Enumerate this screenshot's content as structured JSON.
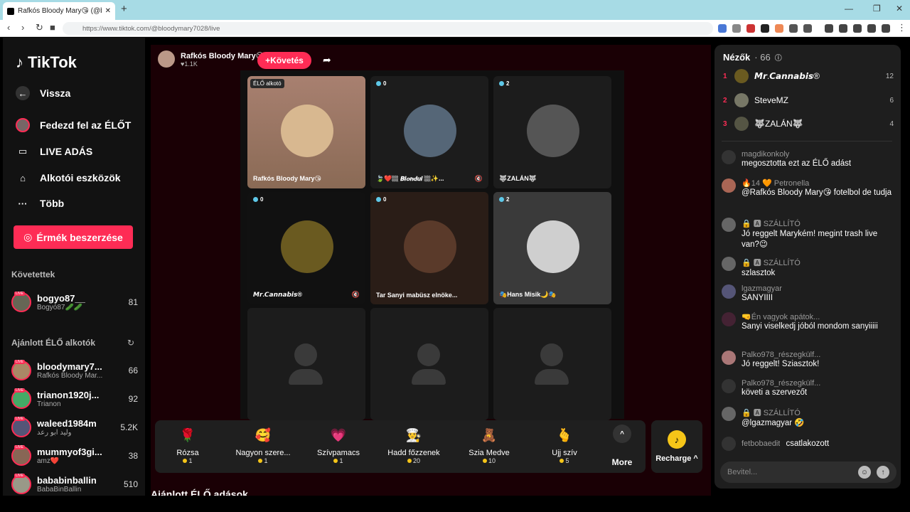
{
  "browser": {
    "tab_title": "Rafkós Bloody Mary😘 (@bl...",
    "url": "https://www.tiktok.com/@bloodymary7028/live"
  },
  "sidebar": {
    "logo": "TikTok",
    "back": "Vissza",
    "nav": [
      {
        "label": "Fedezd fel az ÉLŐT",
        "icon": "avatar-icon"
      },
      {
        "label": "LIVE ADÁS",
        "icon": "video-icon"
      },
      {
        "label": "Alkotói eszközök",
        "icon": "home-icon"
      },
      {
        "label": "Több",
        "icon": "more-icon"
      }
    ],
    "coins_button": "Érmék beszerzése",
    "following_title": "Követettek",
    "following": [
      {
        "name": "bogyo87__",
        "sub": "Bogyó87🥒🥒",
        "count": "81"
      }
    ],
    "recommended_title": "Ajánlott ÉLŐ alkotók",
    "recommended": [
      {
        "name": "bloodymary7...",
        "sub": "Rafkós Bloody Mar...",
        "count": "66"
      },
      {
        "name": "trianon1920j...",
        "sub": "Trianon",
        "count": "92"
      },
      {
        "name": "waleed1984m",
        "sub": "وليد ابو رعد",
        "count": "5.2K"
      },
      {
        "name": "mummyof3gi...",
        "sub": "amz❤️",
        "count": "38"
      },
      {
        "name": "bababinballin",
        "sub": "BabaBinBallin",
        "count": "510"
      }
    ]
  },
  "stream": {
    "host_name": "Rafkós Bloody Mary😘",
    "host_likes": "♥1.1K",
    "follow_label": "+Követés",
    "live_badge": "ÉLŐ alkotó",
    "tiles": [
      {
        "label": "Rafkós Bloody Mary😘",
        "badge": "",
        "color": "#c9a27a",
        "bg": "#8a6a55"
      },
      {
        "label": "🍃❤️🏼 𝘽𝙡𝙤𝙣𝙙𝙪𝙡 🏼✨...",
        "badge": "0",
        "color": "#556677",
        "bg": "#222"
      },
      {
        "label": "🐺ZALÁN🐺",
        "badge": "2",
        "color": "#555",
        "bg": "#1a1a1a"
      },
      {
        "label": "𝙈𝙧.𝘾𝙖𝙣𝙣𝙖𝙗𝙞𝙨®",
        "badge": "0",
        "color": "#6a5a20",
        "bg": "#111"
      },
      {
        "label": "Tar Sanyi mabüsz elnöke...",
        "badge": "0",
        "color": "#5a3a2a",
        "bg": "#2a1d17"
      },
      {
        "label": "🎭Hans Misik🌙🎭",
        "badge": "2",
        "color": "#cfcfcf",
        "bg": "#3a3a3a"
      }
    ],
    "gifts": [
      {
        "name": "Rózsa",
        "price": "1",
        "icon": "🌹"
      },
      {
        "name": "Nagyon szere...",
        "price": "1",
        "icon": "🥰"
      },
      {
        "name": "Szívpamacs",
        "price": "1",
        "icon": "💗"
      },
      {
        "name": "Hadd főzzenek",
        "price": "20",
        "icon": "👨‍🍳"
      },
      {
        "name": "Szia Medve",
        "price": "10",
        "icon": "🧸"
      },
      {
        "name": "Ujj szív",
        "price": "5",
        "icon": "🫰"
      }
    ],
    "more_label": "More",
    "recharge_label": "Recharge ^",
    "recommended_live": "Ajánlott ÉLŐ adások"
  },
  "viewers": {
    "title": "Nézők",
    "count": "· 66",
    "top": [
      {
        "rank": "1",
        "name": "𝙈𝙧.𝘾𝙖𝙣𝙣𝙖𝙗𝙞𝙨®",
        "score": "12"
      },
      {
        "rank": "2",
        "name": "SteveMZ",
        "score": "6"
      },
      {
        "rank": "3",
        "name": "🐺ZALÁN🐺",
        "score": "4"
      }
    ]
  },
  "chat": {
    "messages": [
      {
        "user": "magdikonkoly",
        "text": "megosztotta ezt az ÉLŐ adást"
      },
      {
        "user": "🔥14 🧡 Petronella",
        "text": "@Rafkós Bloody Mary😘 fotelbol de tudja"
      },
      {
        "user": "🔒 🅰 SZÁLLÍTÓ",
        "text": "Jó reggelt Marykém! megint trash live van?😉"
      },
      {
        "user": "🔒 🅰 SZÁLLÍTÓ",
        "text": "szlasztok"
      },
      {
        "user": "lgazmagyar",
        "text": "SANYIIII"
      },
      {
        "user": "🤜Én vagyok apátok...",
        "text": "Sanyi viselkedj jóból mondom sanyiiiii"
      },
      {
        "user": "Palko978_részegkülf...",
        "text": "Jó reggelt! Sziasztok!"
      },
      {
        "user": "Palko978_részegkülf...",
        "text": "követi a szervezőt"
      },
      {
        "user": "🔒 🅰 SZÁLLÍTÓ",
        "text": "@lgazmagyar 🤣"
      },
      {
        "user": "fetbobaedit",
        "text": "csatlakozott"
      }
    ],
    "input_placeholder": "Bevitel..."
  }
}
